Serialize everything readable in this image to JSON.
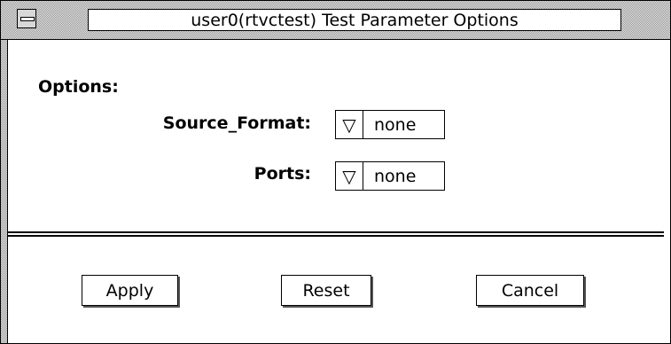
{
  "window": {
    "title": "user0(rtvctest) Test Parameter Options"
  },
  "options": {
    "heading": "Options:",
    "source_format": {
      "label": "Source_Format:",
      "value": "none",
      "arrow": "▽"
    },
    "ports": {
      "label": "Ports:",
      "value": "none",
      "arrow": "▽"
    }
  },
  "buttons": {
    "apply": "Apply",
    "reset": "Reset",
    "cancel": "Cancel"
  },
  "icons": {
    "window_menu": "window-menu-icon",
    "dropdown": "triangle-down-icon"
  }
}
